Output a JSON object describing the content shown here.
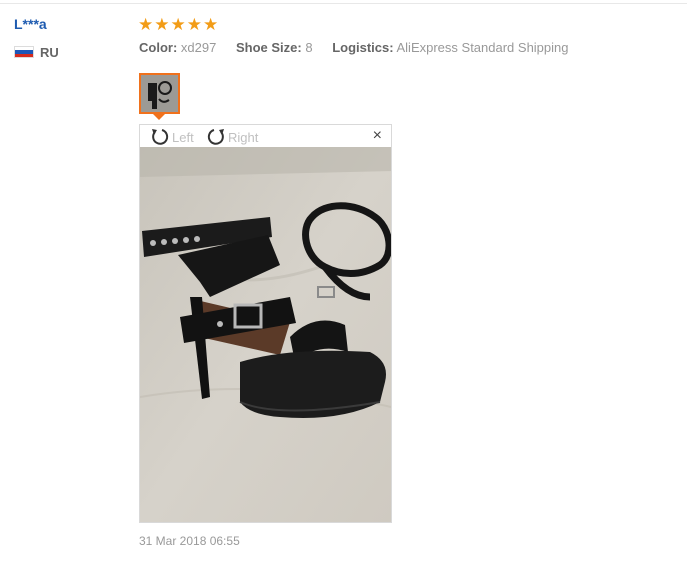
{
  "review": {
    "user_name": "L***a",
    "country_code": "RU",
    "rating": 5,
    "attributes": [
      {
        "key": "Color:",
        "value": "xd297"
      },
      {
        "key": "Shoe Size:",
        "value": "8"
      },
      {
        "key": "Logistics:",
        "value": "AliExpress Standard Shipping"
      }
    ],
    "date": "31 Mar 2018 06:55"
  },
  "viewer": {
    "rotate_left_label": "Left",
    "rotate_right_label": "Right",
    "close_label": "×"
  },
  "colors": {
    "star": "#f29c17",
    "username": "#1e5bb0",
    "thumb_border": "#f0711c"
  }
}
